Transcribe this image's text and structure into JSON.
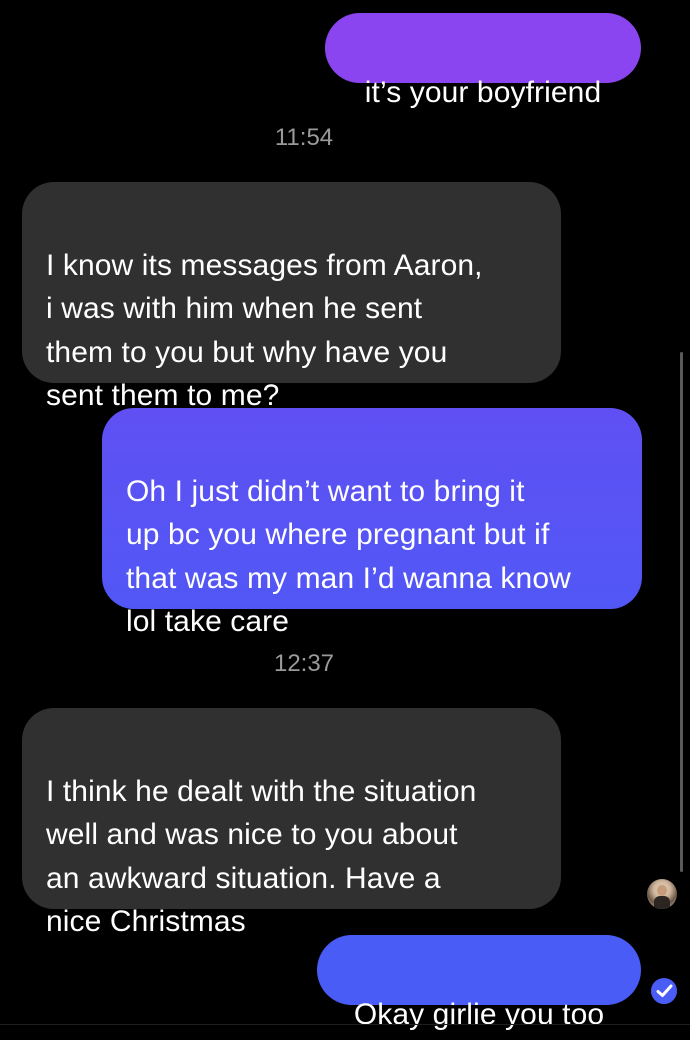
{
  "messages": [
    {
      "id": "msg-1",
      "direction": "outgoing",
      "text": "it’s your boyfriend"
    },
    {
      "id": "msg-2",
      "direction": "incoming",
      "text": "I know its messages from Aaron,\ni was with him when he sent\nthem to you but why have you\nsent them to me?"
    },
    {
      "id": "msg-3",
      "direction": "outgoing",
      "text": "Oh I just didn’t want to bring it\nup bc you where pregnant but if\nthat was my man I’d wanna know\nlol take care"
    },
    {
      "id": "msg-4",
      "direction": "incoming",
      "text": "I think he dealt with the situation\nwell and was nice to you about\nan awkward situation. Have a\nnice Christmas"
    },
    {
      "id": "msg-5",
      "direction": "outgoing",
      "text": "Okay girlie you too"
    }
  ],
  "timestamps": [
    "11:54",
    "12:37"
  ],
  "colors": {
    "background": "#000000",
    "incoming_bubble": "#303030",
    "outgoing_purple": "#8b45f0",
    "outgoing_indigo": "#5157f5",
    "outgoing_blue": "#4a5cf6",
    "timestamp_text": "#9a9a9a"
  },
  "icons": {
    "read_receipt": "contact-avatar-icon",
    "delivered": "checkmark-icon"
  }
}
